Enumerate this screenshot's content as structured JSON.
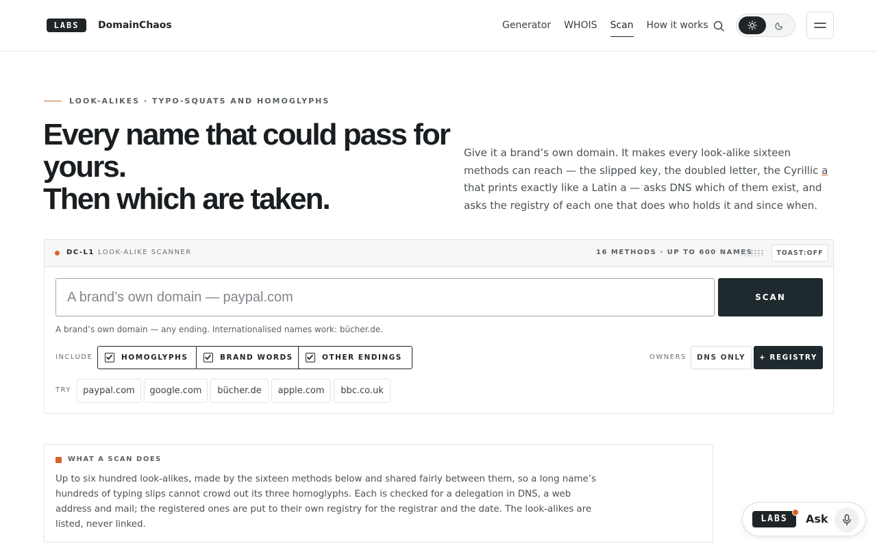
{
  "header": {
    "logo_text": "LABS",
    "brand": "DomainChaos",
    "nav": [
      {
        "label": "Generator",
        "active": false
      },
      {
        "label": "WHOIS",
        "active": false
      },
      {
        "label": "Scan",
        "active": true
      },
      {
        "label": "How it works",
        "active": false
      }
    ],
    "search_icon": "search-icon",
    "theme": {
      "selected": "light",
      "options": [
        "sun-icon",
        "moon-icon"
      ]
    },
    "menu_icon": "hamburger-icon"
  },
  "hero": {
    "eyebrow": "LOOK-ALIKES · TYPO-SQUATS AND HOMOGLYPHS",
    "headline_lines": [
      "Every name that could pass for",
      "yours.",
      "Then which are taken."
    ],
    "intro_before": "Give it a brand’s own domain. It makes every look-alike sixteen methods can reach — the slipped key, the doubled letter, the Cyrillic ",
    "intro_cyrillic": "а",
    "intro_after": " that prints exactly like a Latin a — asks DNS which of them exist, and asks the registry of each one that does who holds it and since when."
  },
  "scanner": {
    "id": "DC-L1",
    "title": "LOOK-ALIKE SCANNER",
    "meta": "16 METHODS · UP TO 600 NAMES",
    "toast": "TOAST:OFF",
    "input_placeholder": "A brand’s own domain — paypal.com",
    "input_value": "",
    "scan_label": "SCAN",
    "hint": "A brand’s own domain — any ending. Internationalised names work: bücher.de.",
    "include_label": "INCLUDE",
    "include_options": [
      {
        "label": "HOMOGLYPHS",
        "checked": true
      },
      {
        "label": "BRAND WORDS",
        "checked": true
      },
      {
        "label": "OTHER ENDINGS",
        "checked": true
      }
    ],
    "owners_label": "OWNERS",
    "owners_options": [
      {
        "label": "DNS ONLY",
        "selected": false
      },
      {
        "label": "+ REGISTRY",
        "selected": true
      }
    ],
    "try_label": "TRY",
    "try_examples": [
      "paypal.com",
      "google.com",
      "bücher.de",
      "apple.com",
      "bbc.co.uk"
    ]
  },
  "info": {
    "title": "WHAT A SCAN DOES",
    "body": "Up to six hundred look-alikes, made by the sixteen methods below and shared fairly between them, so a long name’s hundreds of typing slips cannot crowd out its three homoglyphs. Each is checked for a delegation in DNS, a web address and mail; the registered ones are put to their own registry for the registrar and the date. The look-alikes are listed, never linked."
  },
  "ask_widget": {
    "logo_text": "LABS",
    "label": "Ask",
    "icon": "microphone-icon"
  },
  "colors": {
    "accent": "#d9622b",
    "dark": "#1f2a2e",
    "border": "#e3e4e5"
  }
}
